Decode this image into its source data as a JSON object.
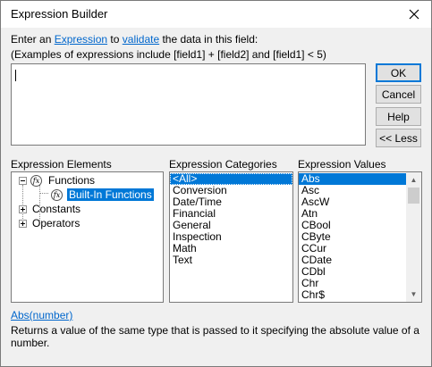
{
  "window": {
    "title": "Expression Builder",
    "close_glyph": "✕"
  },
  "intro": {
    "line1_before": "Enter an ",
    "line1_link1": "Expression",
    "line1_middle": " to ",
    "line1_link2": "validate",
    "line1_after": " the data in this field:",
    "line2": "(Examples of expressions include [field1] + [field2] and [field1] < 5)"
  },
  "expression_box": {
    "value": ""
  },
  "buttons": {
    "ok": "OK",
    "cancel": "Cancel",
    "help": "Help",
    "less": "<< Less"
  },
  "elements": {
    "label": "Expression Elements",
    "tree": {
      "functions": "Functions",
      "builtin": "Built-In Functions",
      "constants": "Constants",
      "operators": "Operators",
      "fx_glyph": "fx"
    }
  },
  "categories": {
    "label": "Expression Categories",
    "items": [
      "<All>",
      "Conversion",
      "Date/Time",
      "Financial",
      "General",
      "Inspection",
      "Math",
      "Text"
    ]
  },
  "values": {
    "label": "Expression Values",
    "items": [
      "Abs",
      "Asc",
      "AscW",
      "Atn",
      "CBool",
      "CByte",
      "CCur",
      "CDate",
      "CDbl",
      "Chr",
      "Chr$"
    ]
  },
  "help": {
    "function_link": "Abs(number)",
    "description": "Returns a value of the same type that is passed to it specifying the absolute value of a number."
  },
  "colors": {
    "selection": "#0078d7",
    "link": "#0066cc",
    "default_button_border": "#0078d7"
  }
}
